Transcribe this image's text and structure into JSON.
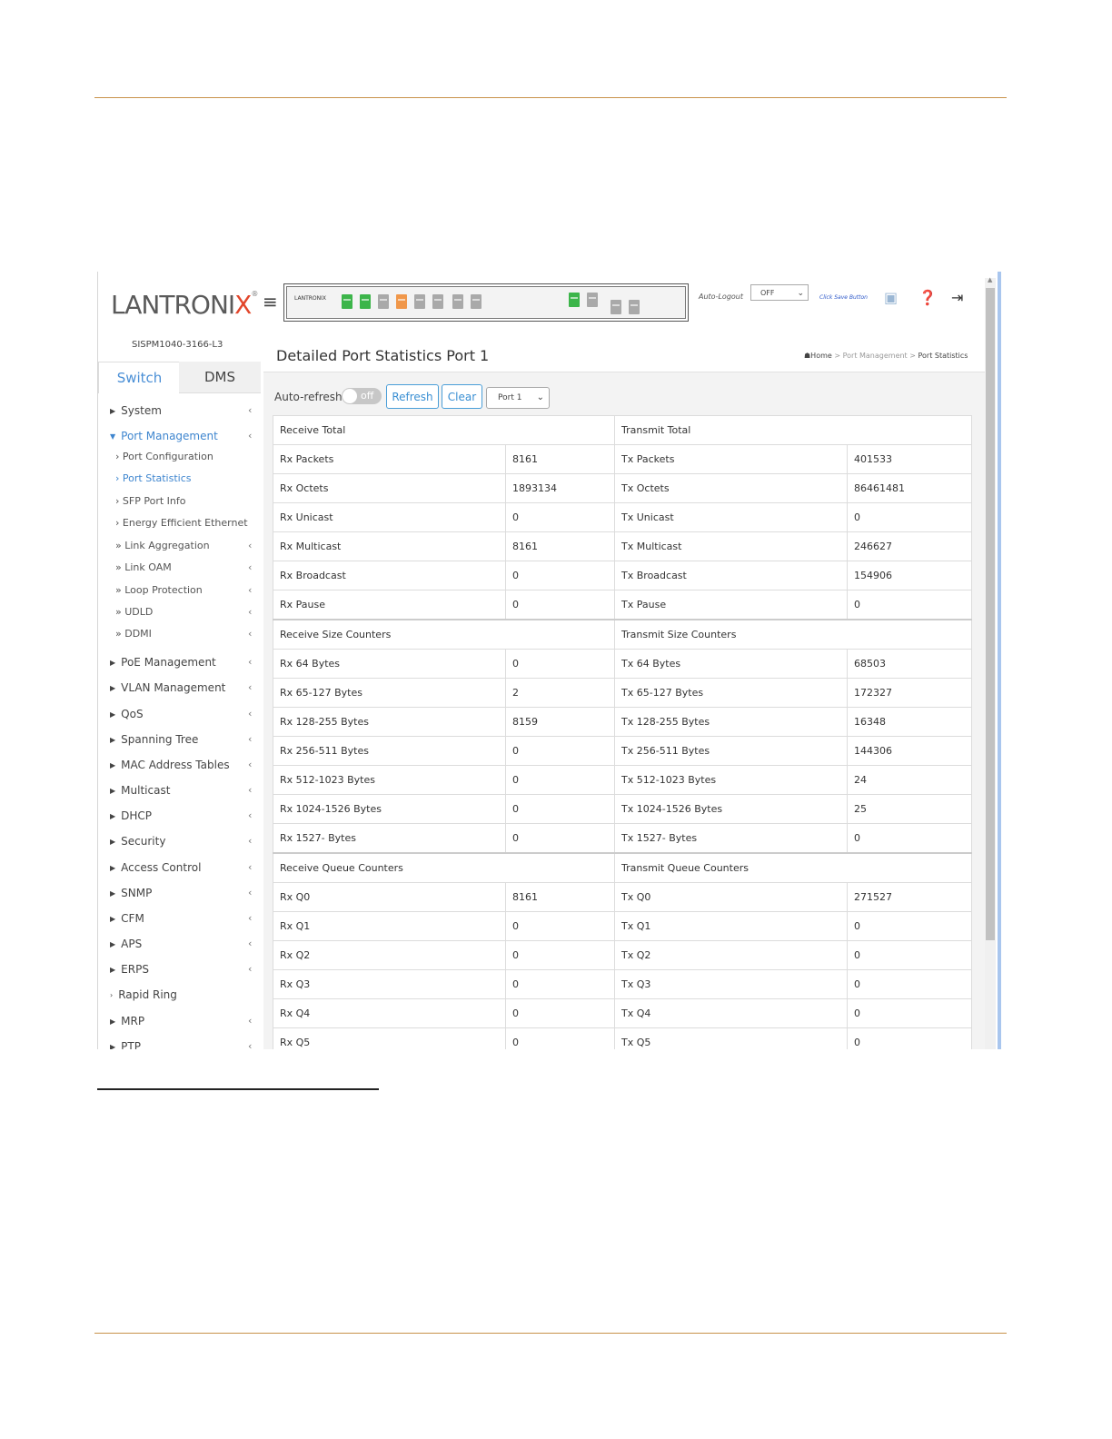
{
  "brand": {
    "name_part1": "LANTRONI",
    "name_part2": "X",
    "reg": "®"
  },
  "header": {
    "panel_logo": "LANTRONIX",
    "auto_logout_label": "Auto-Logout",
    "auto_logout_value": "OFF",
    "save_hint": "Click Save Button"
  },
  "sidebar": {
    "device_name": "SISPM1040-3166-L3",
    "tabs": [
      "Switch",
      "DMS"
    ],
    "items": [
      {
        "label": "System"
      },
      {
        "label": "Port Management"
      },
      {
        "label": "Port Configuration"
      },
      {
        "label": "Port Statistics"
      },
      {
        "label": "SFP Port Info"
      },
      {
        "label": "Energy Efficient Ethernet"
      },
      {
        "label": "Link Aggregation"
      },
      {
        "label": "Link OAM"
      },
      {
        "label": "Loop Protection"
      },
      {
        "label": "UDLD"
      },
      {
        "label": "DDMI"
      },
      {
        "label": "PoE Management"
      },
      {
        "label": "VLAN Management"
      },
      {
        "label": "QoS"
      },
      {
        "label": "Spanning Tree"
      },
      {
        "label": "MAC Address Tables"
      },
      {
        "label": "Multicast"
      },
      {
        "label": "DHCP"
      },
      {
        "label": "Security"
      },
      {
        "label": "Access Control"
      },
      {
        "label": "SNMP"
      },
      {
        "label": "CFM"
      },
      {
        "label": "APS"
      },
      {
        "label": "ERPS"
      },
      {
        "label": "Rapid Ring"
      },
      {
        "label": "MRP"
      },
      {
        "label": "PTP"
      }
    ]
  },
  "page": {
    "title": "Detailed Port Statistics  Port 1",
    "breadcrumb": [
      "Home",
      "Port Management",
      "Port Statistics"
    ],
    "auto_refresh_label": "Auto-refresh",
    "toggle_text": "off",
    "refresh_label": "Refresh",
    "clear_label": "Clear",
    "port_select": "Port 1"
  },
  "stats": {
    "rows": [
      {
        "type": "section",
        "left": "Receive Total",
        "right": "Transmit Total"
      },
      {
        "type": "data",
        "l": "Rx Packets",
        "lv": "8161",
        "r": "Tx Packets",
        "rv": "401533"
      },
      {
        "type": "data",
        "l": "Rx Octets",
        "lv": "1893134",
        "r": "Tx Octets",
        "rv": "86461481"
      },
      {
        "type": "data",
        "l": "Rx Unicast",
        "lv": "0",
        "r": "Tx Unicast",
        "rv": "0"
      },
      {
        "type": "data",
        "l": "Rx Multicast",
        "lv": "8161",
        "r": "Tx Multicast",
        "rv": "246627"
      },
      {
        "type": "data",
        "l": "Rx Broadcast",
        "lv": "0",
        "r": "Tx Broadcast",
        "rv": "154906"
      },
      {
        "type": "data",
        "l": "Rx Pause",
        "lv": "0",
        "r": "Tx Pause",
        "rv": "0"
      },
      {
        "type": "section",
        "left": "Receive Size Counters",
        "right": "Transmit Size Counters"
      },
      {
        "type": "data",
        "l": "Rx 64 Bytes",
        "lv": "0",
        "r": "Tx 64 Bytes",
        "rv": "68503"
      },
      {
        "type": "data",
        "l": "Rx 65-127 Bytes",
        "lv": "2",
        "r": "Tx 65-127 Bytes",
        "rv": "172327"
      },
      {
        "type": "data",
        "l": "Rx 128-255 Bytes",
        "lv": "8159",
        "r": "Tx 128-255 Bytes",
        "rv": "16348"
      },
      {
        "type": "data",
        "l": "Rx 256-511 Bytes",
        "lv": "0",
        "r": "Tx 256-511 Bytes",
        "rv": "144306"
      },
      {
        "type": "data",
        "l": "Rx 512-1023 Bytes",
        "lv": "0",
        "r": "Tx 512-1023 Bytes",
        "rv": "24"
      },
      {
        "type": "data",
        "l": "Rx 1024-1526 Bytes",
        "lv": "0",
        "r": "Tx 1024-1526 Bytes",
        "rv": "25"
      },
      {
        "type": "data",
        "l": "Rx 1527- Bytes",
        "lv": "0",
        "r": "Tx 1527- Bytes",
        "rv": "0"
      },
      {
        "type": "section",
        "left": "Receive Queue Counters",
        "right": "Transmit Queue Counters"
      },
      {
        "type": "data",
        "l": "Rx Q0",
        "lv": "8161",
        "r": "Tx Q0",
        "rv": "271527"
      },
      {
        "type": "data",
        "l": "Rx Q1",
        "lv": "0",
        "r": "Tx Q1",
        "rv": "0"
      },
      {
        "type": "data",
        "l": "Rx Q2",
        "lv": "0",
        "r": "Tx Q2",
        "rv": "0"
      },
      {
        "type": "data",
        "l": "Rx Q3",
        "lv": "0",
        "r": "Tx Q3",
        "rv": "0"
      },
      {
        "type": "data",
        "l": "Rx Q4",
        "lv": "0",
        "r": "Tx Q4",
        "rv": "0"
      },
      {
        "type": "data",
        "l": "Rx Q5",
        "lv": "0",
        "r": "Tx Q5",
        "rv": "0"
      }
    ]
  },
  "colors": {
    "accent_blue": "#3f86cf",
    "rule_gold": "#c8924a",
    "port_green": "#3cb54a",
    "port_orange": "#f0974a",
    "port_gray": "#a9a9a9",
    "logo_red": "#e2462b"
  }
}
